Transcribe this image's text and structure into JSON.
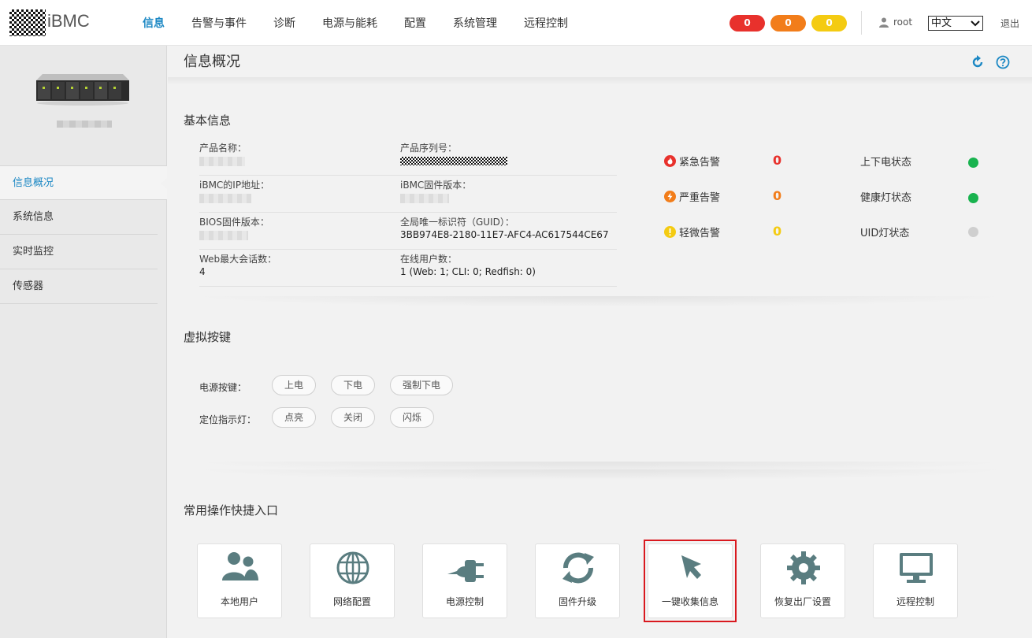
{
  "header": {
    "logo_text": "iBMC",
    "nav": [
      "信息",
      "告警与事件",
      "诊断",
      "电源与能耗",
      "配置",
      "系统管理",
      "远程控制"
    ],
    "alerts": {
      "critical": "0",
      "major": "0",
      "minor": "0"
    },
    "user": "root",
    "language": "中文",
    "logout": "退出"
  },
  "sidebar": {
    "items": [
      "信息概况",
      "系统信息",
      "实时监控",
      "传感器"
    ]
  },
  "page": {
    "title": "信息概况"
  },
  "basic_info": {
    "title": "基本信息",
    "rows": [
      {
        "left_label": "产品名称：",
        "right_label": "产品序列号："
      },
      {
        "left_label": "iBMC的IP地址：",
        "right_label": "iBMC固件版本："
      },
      {
        "left_label": "BIOS固件版本：",
        "right_label": "全局唯一标识符（GUID）：",
        "right_value": "3BB974E8-2180-11E7-AFC4-AC617544CE67"
      },
      {
        "left_label": "Web最大会话数：",
        "left_value": "4",
        "right_label": "在线用户数：",
        "right_value": "1 (Web: 1; CLI: 0; Redfish: 0)"
      }
    ],
    "alarms": [
      {
        "label": "紧急告警",
        "count": "0",
        "color": "#e8312c"
      },
      {
        "label": "严重告警",
        "count": "0",
        "color": "#f27d1a"
      },
      {
        "label": "轻微告警",
        "count": "0",
        "color": "#f4cb12"
      }
    ],
    "statuses": [
      {
        "label": "上下电状态",
        "color": "#19b34f"
      },
      {
        "label": "健康灯状态",
        "color": "#19b34f"
      },
      {
        "label": "UID灯状态",
        "color": "#cfcfcf"
      }
    ]
  },
  "virtual_buttons": {
    "title": "虚拟按键",
    "power_label": "电源按键：",
    "power_buttons": [
      "上电",
      "下电",
      "强制下电"
    ],
    "locate_label": "定位指示灯：",
    "locate_buttons": [
      "点亮",
      "关闭",
      "闪烁"
    ]
  },
  "shortcuts": {
    "title": "常用操作快捷入口",
    "tiles": [
      {
        "label": "本地用户",
        "icon": "users-icon"
      },
      {
        "label": "网络配置",
        "icon": "globe-icon"
      },
      {
        "label": "电源控制",
        "icon": "power-plug-icon"
      },
      {
        "label": "固件升级",
        "icon": "sync-icon"
      },
      {
        "label": "一键收集信息",
        "icon": "cursor-icon"
      },
      {
        "label": "恢复出厂设置",
        "icon": "gear-icon"
      },
      {
        "label": "远程控制",
        "icon": "monitor-icon"
      }
    ],
    "icon_color": "#5a7d80"
  },
  "colors": {
    "accent": "#1c88c4",
    "highlight_border": "#d9191f"
  }
}
